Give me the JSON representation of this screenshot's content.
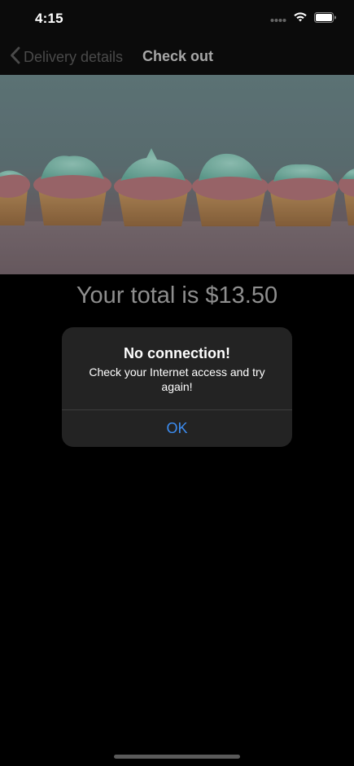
{
  "status_bar": {
    "time": "4:15",
    "icons": [
      "signal-dots-icon",
      "wifi-icon",
      "battery-icon"
    ]
  },
  "nav": {
    "back_label": "Delivery details",
    "title": "Check out"
  },
  "hero": {
    "image_subject": "cupcakes"
  },
  "checkout": {
    "total_text": "Your total is $13.50"
  },
  "alert": {
    "title": "No connection!",
    "message": "Check your Internet access and try again!",
    "ok_label": "OK"
  },
  "colors": {
    "accent": "#3c8cf0",
    "alert_bg": "#232323",
    "background": "#000000"
  }
}
